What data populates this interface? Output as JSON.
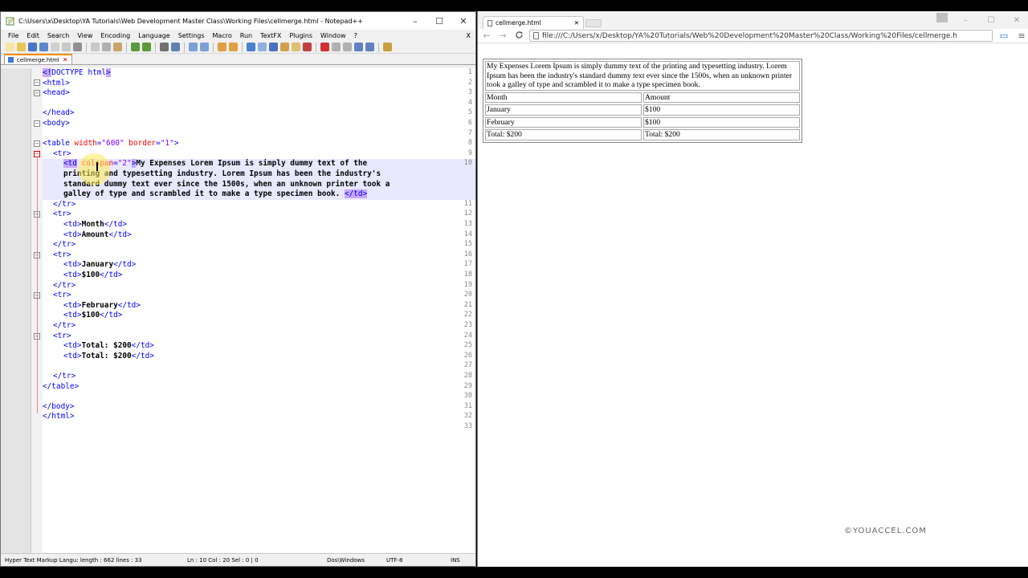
{
  "notepad": {
    "title": "C:\\Users\\x\\Desktop\\YA Tutorials\\Web Development Master Class\\Working Files\\cellmerge.html - Notepad++",
    "window_controls": {
      "minimize": "–",
      "maximize": "☐",
      "close": "✕"
    },
    "menu": [
      "File",
      "Edit",
      "Search",
      "View",
      "Encoding",
      "Language",
      "Settings",
      "Macro",
      "Run",
      "TextFX",
      "Plugins",
      "Window",
      "?"
    ],
    "menu_close": "X",
    "tab": {
      "label": "cellmerge.html",
      "close": "✕"
    },
    "line_numbers": [
      "1",
      "2",
      "3",
      "4",
      "5",
      "6",
      "7",
      "8",
      "9",
      "10",
      "",
      "",
      "",
      "11",
      "12",
      "13",
      "14",
      "15",
      "16",
      "17",
      "18",
      "19",
      "20",
      "21",
      "22",
      "23",
      "24",
      "25",
      "26",
      "27",
      "28",
      "29",
      "30",
      "31",
      "32",
      "33"
    ],
    "status": {
      "type": "Hyper Text Markup Langu: length : 662    lines : 33",
      "position": "Ln : 10    Col : 20    Sel : 0 | 0",
      "eol": "Dos\\Windows",
      "encoding": "UTF-8",
      "mode": "INS"
    }
  },
  "code": {
    "l1_a": "<!",
    "l1_b": "DOCTYPE html",
    "l1_c": ">",
    "l2": "<html>",
    "l3": "<head>",
    "l5": "</head>",
    "l6": "<body>",
    "l8_a": "<table ",
    "l8_b": "width",
    "l8_c": "=",
    "l8_d": "\"600\"",
    "l8_e": " ",
    "l8_f": "border",
    "l8_g": "=",
    "l8_h": "\"1\"",
    "l8_i": ">",
    "l9": "<tr>",
    "l10_a": "<td",
    "l10_b": " colspan",
    "l10_c": "=",
    "l10_d": "\"2\"",
    "l10_e": ">",
    "l10_f": "My Expenses Lorem Ipsum is simply dummy text of the",
    "l10_w1": "printing and typesetting industry. Lorem Ipsum has been the industry's",
    "l10_w2": "standard dummy text ever since the 1500s, when an unknown printer took a",
    "l10_w3a": "galley of type and scrambled it to make a type specimen book. ",
    "l10_w3b": "</td>",
    "l11": "</tr>",
    "l12": "<tr>",
    "l13_a": "<td>",
    "l13_b": "Month",
    "l13_c": "</td>",
    "l14_a": "<td>",
    "l14_b": "Amount",
    "l14_c": "</td>",
    "l15": "</tr>",
    "l16": "<tr>",
    "l17_a": "<td>",
    "l17_b": "January",
    "l17_c": "</td>",
    "l18_a": "<td>",
    "l18_b": "$100",
    "l18_c": "</td>",
    "l19": "</tr>",
    "l20": "<tr>",
    "l21_a": "<td>",
    "l21_b": "February",
    "l21_c": "</td>",
    "l22_a": "<td>",
    "l22_b": "$100",
    "l22_c": "</td>",
    "l23": "</tr>",
    "l24": "<tr>",
    "l25_a": "<td>",
    "l25_b": "Total: $200",
    "l25_c": "</td>",
    "l26_a": "<td>",
    "l26_b": "Total: $200",
    "l26_c": "</td>",
    "l28": "</tr>",
    "l29": "</table>",
    "l31": "</body>",
    "l32": "</html>"
  },
  "browser": {
    "tab_title": "cellmerge.html",
    "tab_close": "✕",
    "url": "file:///C:/Users/x/Desktop/YA%20Tutorials/Web%20Development%20Master%20Class/Working%20Files/cellmerge.h",
    "controls": {
      "minimize": "–",
      "maximize": "☐",
      "close": "✕"
    },
    "nav": {
      "back": "←",
      "forward": "→",
      "reload": "C"
    },
    "table": {
      "header_cell": "My Expenses Lorem Ipsum is simply dummy text of the printing and typesetting industry. Lorem Ipsum has been the industry's standard dummy text ever since the 1500s, when an unknown printer took a galley of type and scrambled it to make a type specimen book.",
      "rows": [
        [
          "Month",
          "Amount"
        ],
        [
          "January",
          "$100"
        ],
        [
          "February",
          "$100"
        ],
        [
          "Total: $200",
          "Total: $200"
        ]
      ]
    }
  },
  "watermark": "©YOUACCEL.COM"
}
